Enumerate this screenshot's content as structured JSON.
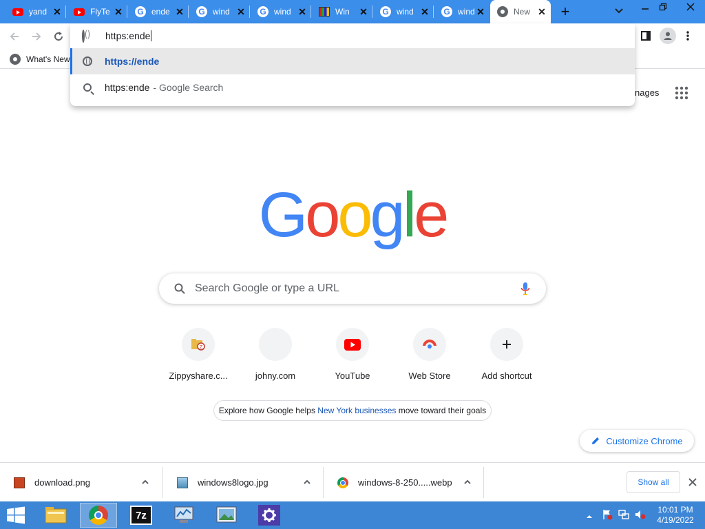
{
  "tabs": [
    {
      "title": "yand",
      "icon": "youtube-icon"
    },
    {
      "title": "FlyTe",
      "icon": "youtube-icon"
    },
    {
      "title": "ende",
      "icon": "google-icon"
    },
    {
      "title": "wind",
      "icon": "google-icon"
    },
    {
      "title": "wind",
      "icon": "google-icon"
    },
    {
      "title": "Win",
      "icon": "windows-logo-icon"
    },
    {
      "title": "wind",
      "icon": "google-icon"
    },
    {
      "title": "wind",
      "icon": "google-icon"
    },
    {
      "title": "New",
      "icon": "chrome-icon",
      "active": true
    }
  ],
  "omnibox": {
    "input_value": "https:ende",
    "suggestions": [
      {
        "text": "https://ende",
        "icon": "globe-icon",
        "selected": true
      },
      {
        "text": "https:ende",
        "suffix": "- Google Search",
        "icon": "search-icon"
      }
    ]
  },
  "bookmarks_bar": {
    "item_label": "What's New"
  },
  "header_links": {
    "images_partial": "nages"
  },
  "search": {
    "placeholder": "Search Google or type a URL"
  },
  "shortcuts": [
    {
      "label": "Zippyshare.c...",
      "icon": "zippyshare-icon"
    },
    {
      "label": "johny.com",
      "icon": "blank-site-icon"
    },
    {
      "label": "YouTube",
      "icon": "youtube-icon"
    },
    {
      "label": "Web Store",
      "icon": "web-store-icon"
    },
    {
      "label": "Add shortcut",
      "icon": "plus-icon"
    }
  ],
  "promo": {
    "before": "Explore how Google helps ",
    "link": "New York businesses",
    "after": " move toward their goals"
  },
  "customize_label": "Customize Chrome",
  "downloads": [
    {
      "name": "download.png",
      "icon": "image-file-icon"
    },
    {
      "name": "windows8logo.jpg",
      "icon": "image-file-icon"
    },
    {
      "name": "windows-8-250.....webp",
      "icon": "chrome-icon"
    }
  ],
  "downloads_show_all": "Show all",
  "clock": {
    "time": "10:01 PM",
    "date": "4/19/2022"
  },
  "colors": {
    "tabstrip": "#3b8eea",
    "taskbar": "#3d86d6",
    "accent": "#1a73e8"
  }
}
